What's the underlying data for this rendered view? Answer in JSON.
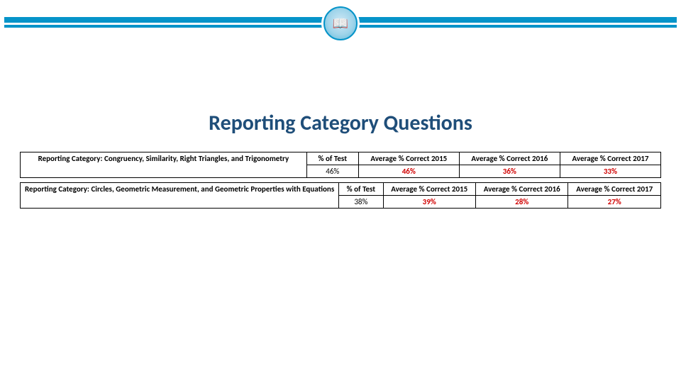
{
  "title": "Reporting Category Questions",
  "columns": {
    "pct_of_test": "% of Test",
    "avg_2015": "Average % Correct 2015",
    "avg_2016": "Average % Correct 2016",
    "avg_2017": "Average % Correct 2017"
  },
  "categories": [
    {
      "lead": "Reporting Category:",
      "name": "Congruency, Similarity, Right Triangles, and Trigonometry",
      "pct_of_test": "46%",
      "avg_2015": "46%",
      "avg_2016": "36%",
      "avg_2017": "33%",
      "color": "pink"
    },
    {
      "lead": "Reporting Category:",
      "name": "Circles, Geometric Measurement, and Geometric Properties with Equations",
      "pct_of_test": "38%",
      "avg_2015": "39%",
      "avg_2016": "28%",
      "avg_2017": "27%",
      "color": "red"
    }
  ],
  "chart_data": [
    {
      "type": "table",
      "title": "Reporting Category: Congruency, Similarity, Right Triangles, and Trigonometry",
      "columns": [
        "% of Test",
        "Average % Correct 2015",
        "Average % Correct 2016",
        "Average % Correct 2017"
      ],
      "values": [
        46,
        46,
        36,
        33
      ]
    },
    {
      "type": "table",
      "title": "Reporting Category: Circles, Geometric Measurement, and Geometric Properties with Equations",
      "columns": [
        "% of Test",
        "Average % Correct 2015",
        "Average % Correct 2016",
        "Average % Correct 2017"
      ],
      "values": [
        38,
        39,
        28,
        27
      ]
    }
  ]
}
